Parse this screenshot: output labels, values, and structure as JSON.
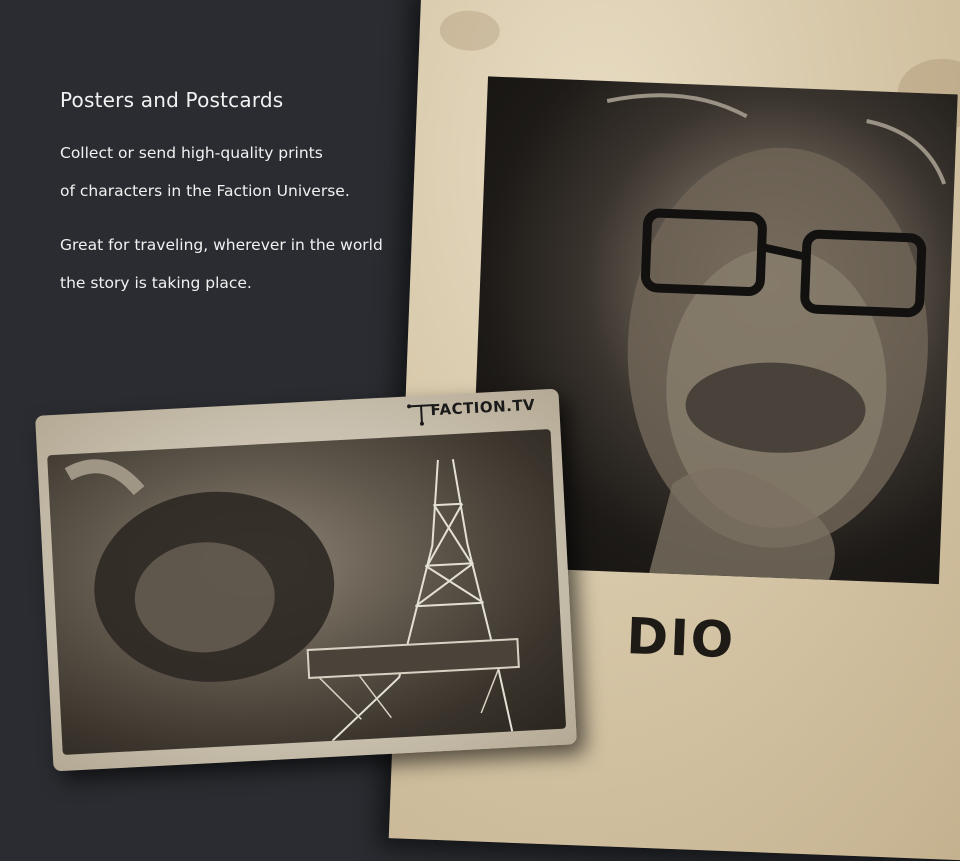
{
  "intro": {
    "heading": "Posters and Postcards",
    "paragraph_1_line_1": "Collect or send high-quality prints",
    "paragraph_1_line_2": "of characters in the Faction Universe.",
    "paragraph_2_line_1": "Great for traveling, wherever in the world",
    "paragraph_2_line_2": "the story is taking place."
  },
  "poster": {
    "name": "DIO"
  },
  "postcard": {
    "logo": "FACTION.TV"
  },
  "colors": {
    "background": "#2a2c31",
    "paper": "#d6c7a8",
    "text": "#f2f2f2"
  }
}
